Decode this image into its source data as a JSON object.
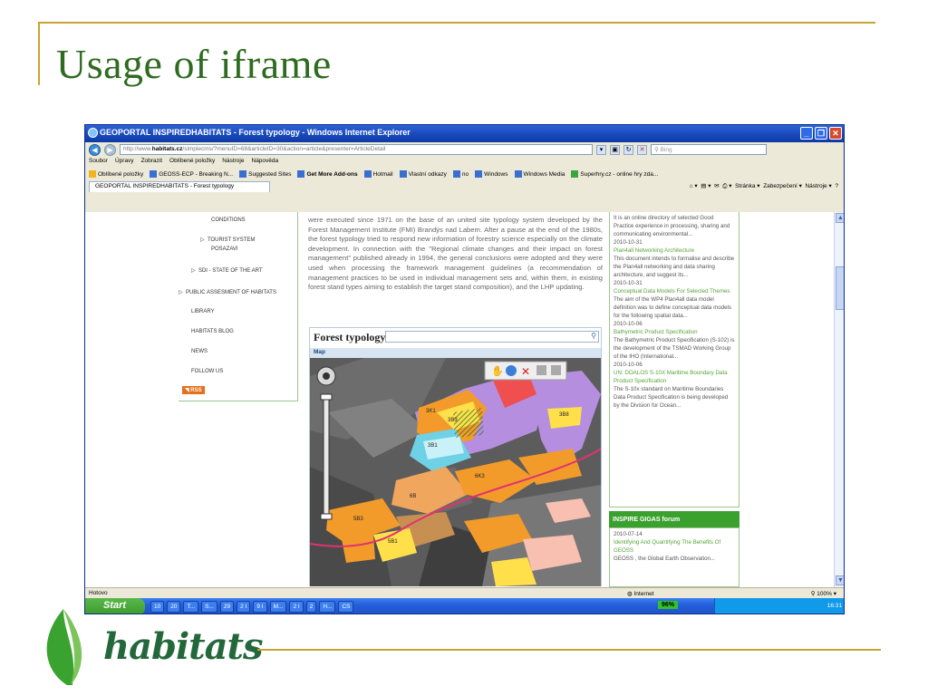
{
  "slide": {
    "title": "Usage of iframe",
    "logo_text": "habitats"
  },
  "browser": {
    "window_title": "GEOPORTAL INSPIREDHABITATS - Forest typology - Windows Internet Explorer",
    "url_prefix": "http://www.",
    "url_host": "habitats.cz",
    "url_rest": "/simplecms/?menuID=68&articleID=30&action=article&presenter=ArticleDetail",
    "search_placeholder": "Bing",
    "menu": [
      "Soubor",
      "Úpravy",
      "Zobrazit",
      "Oblíbené položky",
      "Nástroje",
      "Nápověda"
    ],
    "favorites": [
      {
        "label": "Oblíbené položky",
        "icon": "star-icon"
      },
      {
        "label": "GEOSS-ECP - Breaking N...",
        "icon": "page-icon"
      },
      {
        "label": "Suggested Sites",
        "icon": "page-icon"
      },
      {
        "label": "Get More Add-ons",
        "icon": "page-icon"
      },
      {
        "label": "Hotmail",
        "icon": "msn-icon"
      },
      {
        "label": "Vlastní odkazy",
        "icon": "msn-icon"
      },
      {
        "label": "no",
        "icon": "page-icon"
      },
      {
        "label": "Windows",
        "icon": "msn-icon"
      },
      {
        "label": "Windows Media",
        "icon": "msn-icon"
      },
      {
        "label": "Superhry.cz - online hry zda...",
        "icon": "game-icon"
      }
    ],
    "tab_label": "GEOPORTAL INSPIREDHABITATS - Forest typology",
    "tab_tools": [
      "Stránka",
      "Zabezpečení",
      "Nástroje"
    ],
    "status_text": "Hotovo",
    "zone": "Internet",
    "zoom": "100%"
  },
  "page": {
    "left_nav": [
      "CONDITIONS",
      "TOURIST SYSTEM",
      "POSAZAVI",
      "SDI - STATE OF THE ART",
      "PUBLIC ASSESMENT OF HABITATS",
      "LIBRARY",
      "HABITATS BLOG",
      "NEWS",
      "FOLLOW US",
      "RSS"
    ],
    "article_text": "were executed since 1971 on the base of an united site typology system developed by the Forest Management Institute (FMI) Brandýs nad Labem. After a pause at the end of the 1980s, the forest typology tried to respond new information of forestry science especially on the climate development. In connection with the \"Regional climate changes and their impact on forest management\" published already in 1994, the general conclusions were adopted and they were used when processing the framework management guidelines (a recommendation of management practices to be used in individual management sets and, within them, in existing forest stand types aiming to establish the target stand composition), and the LHP updating.",
    "map_widget_title": "Forest typology",
    "map_label": "Map",
    "map_polygon_labels": [
      "3K1",
      "3B3",
      "3B8",
      "3B1",
      "6K3",
      "6B",
      "5B3",
      "5B1"
    ],
    "news": [
      {
        "text": "It is an online directory of selected Good Practice experience in processing, sharing and communicating environmental..."
      },
      {
        "date": "2010-10-31"
      },
      {
        "title": "Plan4all Networking Architecture"
      },
      {
        "text": "This document intends to formalise and describe the Plan4all networking and data sharing architecture, and suggest its..."
      },
      {
        "date": "2010-10-31"
      },
      {
        "title": "Conceptual Data Models For Selected Themes"
      },
      {
        "text": "The aim of the WP4 Plan4all data model definition was to define conceptual data models for the following spatial data..."
      },
      {
        "date": "2010-10-06"
      },
      {
        "title": "Bathymetric Product Specification"
      },
      {
        "text": "The Bathymetric Product Specification (S-102) is the development of the TSMAD Working Group of the IHO (International..."
      },
      {
        "date": "2010-10-06"
      },
      {
        "title": "UN: DOALOS S-10X Maritime Boundary Data Product Specification"
      },
      {
        "text": "The S-10x standard on Maritime Boundaries Data Product Specification is being developed by the Division for Ocean..."
      }
    ],
    "forum_header": "INSPIRE GIGAS forum",
    "forum": {
      "date": "2010-07-14",
      "title": "Identifying And Quantifying The Benefits Of GEOSS",
      "text": "GEOSS , the Global Earth Observation..."
    }
  },
  "taskbar": {
    "start_label": "Start",
    "tasks": [
      "10",
      "20",
      "T...",
      "S...",
      "29",
      "2 I",
      "9 I",
      "M...",
      "2 I",
      "2",
      "H...",
      "CS"
    ],
    "battery": "96%",
    "clock": "16:31"
  },
  "colors": {
    "title_green": "#2e6b1f",
    "rule_gold": "#c9a233",
    "xp_blue": "#245edb",
    "forum_green": "#3aa12f"
  }
}
